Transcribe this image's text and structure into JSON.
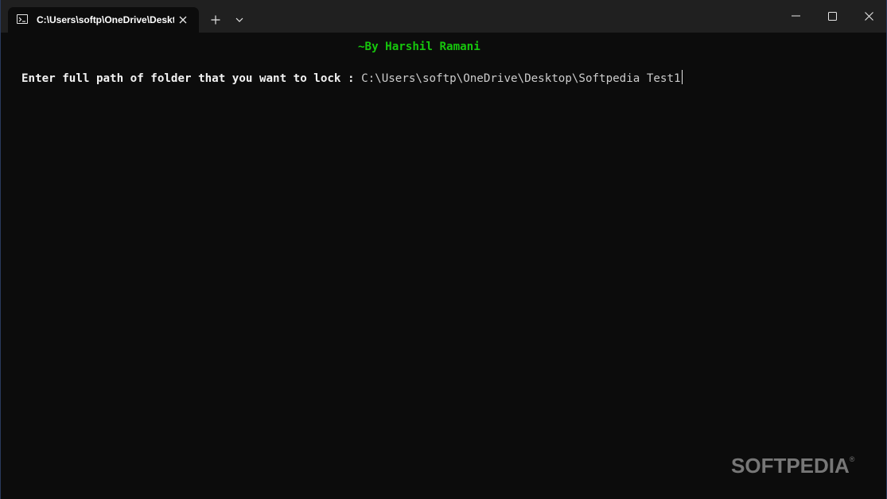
{
  "window": {
    "tab_title": "C:\\Users\\softp\\OneDrive\\Desktop",
    "tab_icon": "terminal-icon",
    "icons": {
      "close_tab": "close-icon",
      "new_tab": "plus-icon",
      "dropdown": "chevron-down-icon",
      "minimize": "minimize-icon",
      "maximize": "maximize-icon",
      "close": "close-icon"
    }
  },
  "console": {
    "banner": "~By Harshil Ramani",
    "prompt_label": "Enter full path of folder that you want to lock : ",
    "input_value": "C:\\Users\\softp\\OneDrive\\Desktop\\Softpedia Test1"
  },
  "watermark": {
    "text": "SOFTPEDIA",
    "mark": "®"
  },
  "colors": {
    "background": "#0c0c0c",
    "titlebar": "#202020",
    "banner": "#16c60c",
    "text": "#f2f2f2"
  }
}
